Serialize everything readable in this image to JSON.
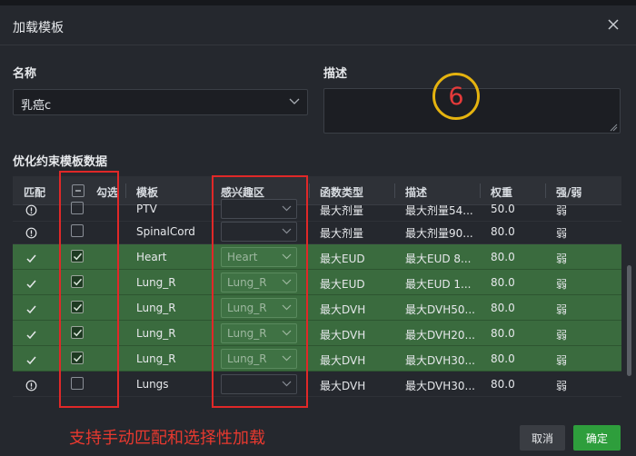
{
  "dialog": {
    "title": "加载模板"
  },
  "form": {
    "name_label": "名称",
    "name_value": "乳癌c",
    "desc_label": "描述",
    "desc_value": ""
  },
  "annotation_badge": "6",
  "section_title": "优化约束模板数据",
  "columns": [
    "匹配",
    "勾选",
    "模板",
    "感兴趣区",
    "函数类型",
    "描述",
    "权重",
    "强/弱"
  ],
  "rows": [
    {
      "match": "info",
      "checked": false,
      "template": "PTV",
      "roi": "",
      "func": "最大剂量",
      "desc": "最大剂量54...",
      "weight": "50.0",
      "strength": "弱",
      "matched": false
    },
    {
      "match": "info",
      "checked": false,
      "template": "SpinalCord",
      "roi": "",
      "func": "最大剂量",
      "desc": "最大剂量90...",
      "weight": "80.0",
      "strength": "弱",
      "matched": false
    },
    {
      "match": "check",
      "checked": true,
      "template": "Heart",
      "roi": "Heart",
      "func": "最大EUD",
      "desc": "最大EUD 8...",
      "weight": "80.0",
      "strength": "弱",
      "matched": true
    },
    {
      "match": "check",
      "checked": true,
      "template": "Lung_R",
      "roi": "Lung_R",
      "func": "最大EUD",
      "desc": "最大EUD 1...",
      "weight": "80.0",
      "strength": "弱",
      "matched": true
    },
    {
      "match": "check",
      "checked": true,
      "template": "Lung_R",
      "roi": "Lung_R",
      "func": "最大DVH",
      "desc": "最大DVH50...",
      "weight": "80.0",
      "strength": "弱",
      "matched": true
    },
    {
      "match": "check",
      "checked": true,
      "template": "Lung_R",
      "roi": "Lung_R",
      "func": "最大DVH",
      "desc": "最大DVH20...",
      "weight": "80.0",
      "strength": "弱",
      "matched": true
    },
    {
      "match": "check",
      "checked": true,
      "template": "Lung_R",
      "roi": "Lung_R",
      "func": "最大DVH",
      "desc": "最大DVH30...",
      "weight": "80.0",
      "strength": "弱",
      "matched": true
    },
    {
      "match": "info",
      "checked": false,
      "template": "Lungs",
      "roi": "",
      "func": "最大DVH",
      "desc": "最大DVH30...",
      "weight": "80.0",
      "strength": "弱",
      "matched": false
    }
  ],
  "annotation_text": "支持手动匹配和选择性加载",
  "buttons": {
    "cancel": "取消",
    "ok": "确定"
  },
  "colors": {
    "matched_row": "#3a6b3e",
    "ok_button": "#2e9e3c",
    "annotation": "#e8392f",
    "badge_ring": "#e5b30f"
  }
}
